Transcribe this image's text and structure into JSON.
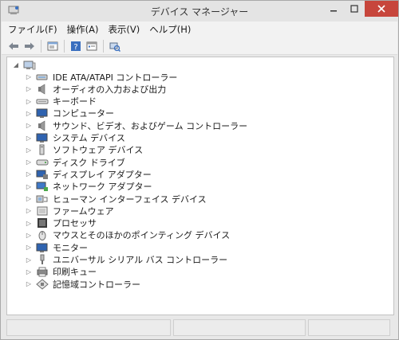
{
  "window": {
    "title": "デバイス マネージャー"
  },
  "menu": [
    "ファイル(F)",
    "操作(A)",
    "表示(V)",
    "ヘルプ(H)"
  ],
  "toolbar": [
    "back",
    "forward",
    "properties",
    "help",
    "show-hidden",
    "scan-hardware"
  ],
  "tree": {
    "root": {
      "icon": "computer-icon",
      "expanded": true
    },
    "items": [
      {
        "label": "IDE ATA/ATAPI コントローラー",
        "icon": "ide-controller-icon"
      },
      {
        "label": "オーディオの入力および出力",
        "icon": "speaker-icon"
      },
      {
        "label": "キーボード",
        "icon": "keyboard-icon"
      },
      {
        "label": "コンピューター",
        "icon": "monitor-icon"
      },
      {
        "label": "サウンド、ビデオ、およびゲーム コントローラー",
        "icon": "speaker-icon"
      },
      {
        "label": "システム デバイス",
        "icon": "monitor-icon"
      },
      {
        "label": "ソフトウェア デバイス",
        "icon": "software-device-icon"
      },
      {
        "label": "ディスク ドライブ",
        "icon": "disk-drive-icon"
      },
      {
        "label": "ディスプレイ アダプター",
        "icon": "display-adapter-icon"
      },
      {
        "label": "ネットワーク アダプター",
        "icon": "network-adapter-icon"
      },
      {
        "label": "ヒューマン インターフェイス デバイス",
        "icon": "hid-icon"
      },
      {
        "label": "ファームウェア",
        "icon": "firmware-icon"
      },
      {
        "label": "プロセッサ",
        "icon": "processor-icon"
      },
      {
        "label": "マウスとそのほかのポインティング デバイス",
        "icon": "mouse-icon"
      },
      {
        "label": "モニター",
        "icon": "monitor-icon"
      },
      {
        "label": "ユニバーサル シリアル バス コントローラー",
        "icon": "usb-icon"
      },
      {
        "label": "印刷キュー",
        "icon": "printer-icon"
      },
      {
        "label": "記憶域コントローラー",
        "icon": "storage-controller-icon"
      }
    ]
  },
  "colors": {
    "close_button": "#c7463c",
    "tree_background": "#ffffff",
    "chrome": "#e8e8e8"
  }
}
